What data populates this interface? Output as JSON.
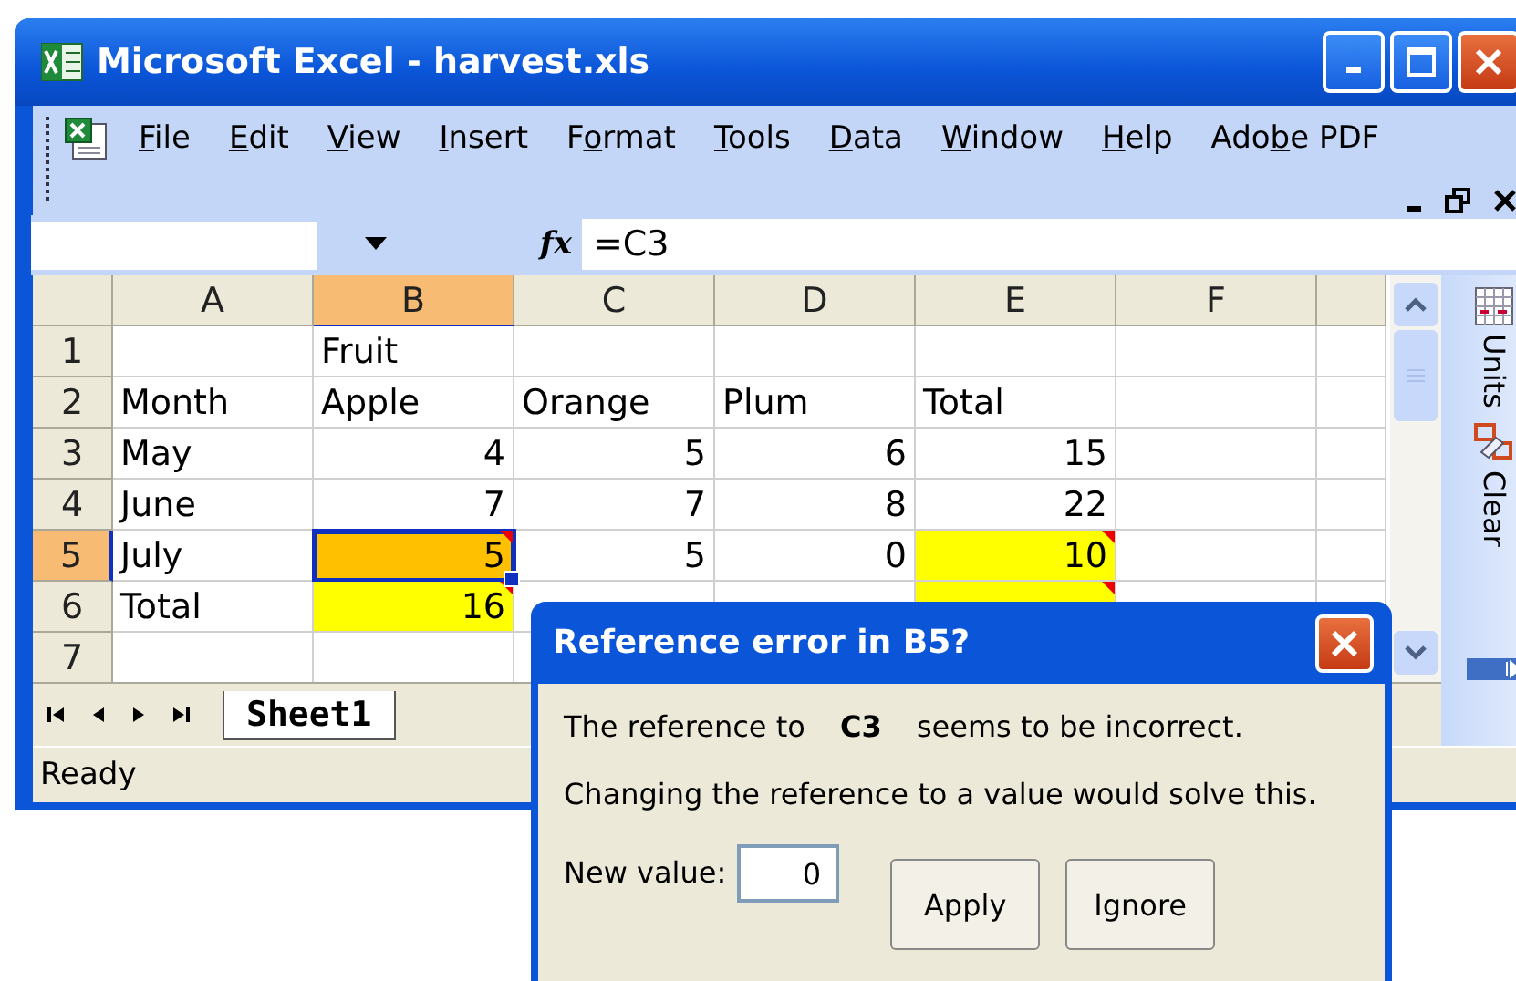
{
  "window": {
    "title": "Microsoft Excel - harvest.xls"
  },
  "menu": [
    {
      "key": "F",
      "post": "ile"
    },
    {
      "key": "E",
      "post": "dit"
    },
    {
      "key": "V",
      "post": "iew"
    },
    {
      "key": "I",
      "post": "nsert"
    },
    {
      "pre": "F",
      "key": "o",
      "post": "rmat"
    },
    {
      "key": "T",
      "post": "ools"
    },
    {
      "key": "D",
      "post": "ata"
    },
    {
      "key": "W",
      "post": "indow"
    },
    {
      "key": "H",
      "post": "elp"
    },
    {
      "pre": "Ado",
      "key": "b",
      "post": "e PDF"
    }
  ],
  "formula_bar": {
    "function_label": "fx",
    "formula": "=C3"
  },
  "columns": [
    {
      "label": "A",
      "selected": false
    },
    {
      "label": "B",
      "selected": true
    },
    {
      "label": "C",
      "selected": false
    },
    {
      "label": "D",
      "selected": false
    },
    {
      "label": "E",
      "selected": false
    },
    {
      "label": "F",
      "selected": false
    }
  ],
  "rows": [
    {
      "header": "1",
      "selected": false,
      "cells": [
        {
          "selected": false
        },
        {
          "text": "Fruit",
          "kind": "text",
          "selected": false
        },
        {
          "selected": false
        },
        {
          "selected": false
        },
        {
          "selected": false
        },
        {
          "selected": false
        }
      ]
    },
    {
      "header": "2",
      "selected": false,
      "cells": [
        {
          "text": "Month",
          "kind": "text",
          "selected": false
        },
        {
          "text": "Apple",
          "kind": "text",
          "selected": false
        },
        {
          "text": "Orange",
          "kind": "text",
          "selected": false
        },
        {
          "text": "Plum",
          "kind": "text",
          "selected": false
        },
        {
          "text": "Total",
          "kind": "text",
          "selected": false
        },
        {
          "selected": false
        }
      ]
    },
    {
      "header": "3",
      "selected": false,
      "cells": [
        {
          "text": "May",
          "kind": "text",
          "selected": false
        },
        {
          "text": "4",
          "kind": "number",
          "selected": false
        },
        {
          "text": "5",
          "kind": "number",
          "selected": false
        },
        {
          "text": "6",
          "kind": "number",
          "selected": false
        },
        {
          "text": "15",
          "kind": "number",
          "selected": false
        },
        {
          "selected": false
        }
      ]
    },
    {
      "header": "4",
      "selected": false,
      "cells": [
        {
          "text": "June",
          "kind": "text",
          "selected": false
        },
        {
          "text": "7",
          "kind": "number",
          "selected": false
        },
        {
          "text": "7",
          "kind": "number",
          "selected": false
        },
        {
          "text": "8",
          "kind": "number",
          "selected": false
        },
        {
          "text": "22",
          "kind": "number",
          "selected": false
        },
        {
          "selected": false
        }
      ]
    },
    {
      "header": "5",
      "selected": true,
      "cells": [
        {
          "text": "July",
          "kind": "text",
          "selected": false
        },
        {
          "text": "5",
          "kind": "number",
          "color": "#ffc000",
          "comment": true,
          "selected": true
        },
        {
          "text": "5",
          "kind": "number",
          "selected": false
        },
        {
          "text": "0",
          "kind": "number",
          "selected": false
        },
        {
          "text": "10",
          "kind": "number",
          "color": "#ffff00",
          "comment": true,
          "selected": false
        },
        {
          "selected": false
        }
      ]
    },
    {
      "header": "6",
      "selected": false,
      "cells": [
        {
          "text": "Total",
          "kind": "text",
          "selected": false
        },
        {
          "text": "16",
          "kind": "number",
          "color": "#ffff00",
          "comment": true,
          "selected": false
        },
        {
          "selected": false
        },
        {
          "selected": false
        },
        {
          "color": "#ffff00",
          "comment": true,
          "selected": false
        },
        {
          "selected": false
        }
      ]
    },
    {
      "header": "7",
      "selected": false,
      "cells": [
        {
          "selected": false
        },
        {
          "selected": false
        }
      ]
    }
  ],
  "sheet_tabs": [
    {
      "label": "Sheet1",
      "selected": true
    }
  ],
  "task_panel": [
    {
      "label": "Units",
      "kind": "units"
    },
    {
      "label": "Clear",
      "kind": "clear"
    }
  ],
  "status_bar": {
    "text": "Ready"
  },
  "dialog": {
    "title": "Reference error in B5?",
    "message": "The reference to **C3** seems to be incorrect.",
    "hint": "Changing the reference to a value would solve this.",
    "field_label": "New value:",
    "value": "0",
    "buttons": [
      "Apply",
      "Ignore"
    ]
  }
}
